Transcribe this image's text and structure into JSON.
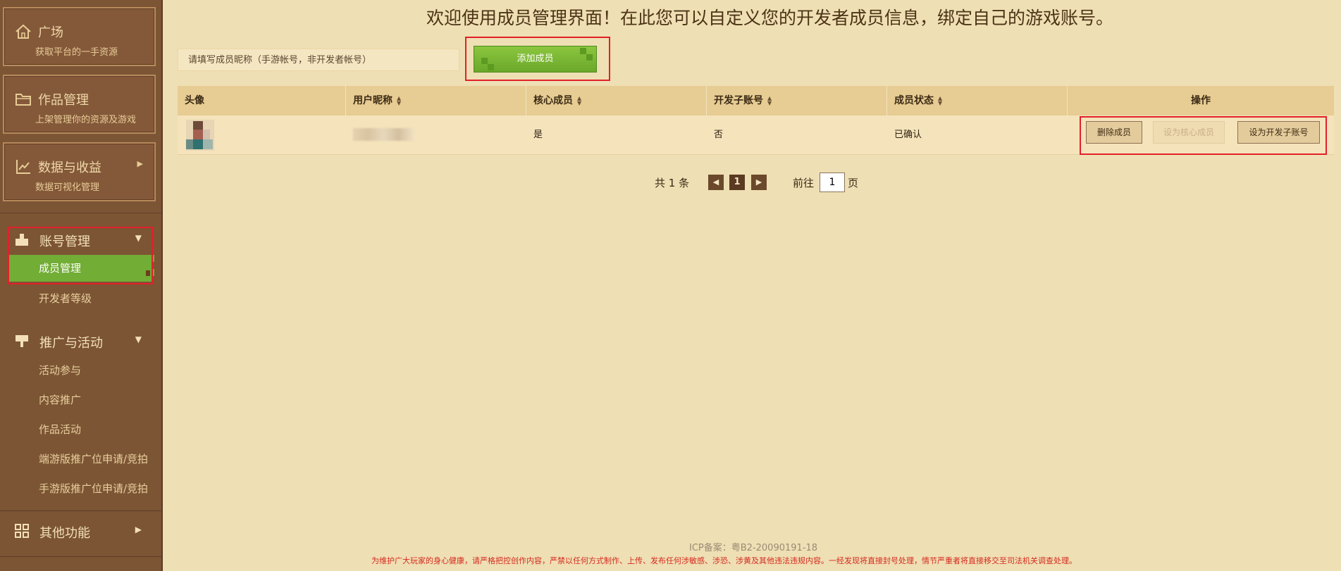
{
  "welcome": "欢迎使用成员管理界面！在此您可以自定义您的开发者成员信息，绑定自己的游戏账号。",
  "sidebar": {
    "cards": [
      {
        "title": "广场",
        "subtitle": "获取平台的一手资源",
        "icon": "home-icon"
      },
      {
        "title": "作品管理",
        "subtitle": "上架管理你的资源及游戏",
        "icon": "folder-icon"
      },
      {
        "title": "数据与收益",
        "subtitle": "数据可视化管理",
        "icon": "chart-icon"
      }
    ],
    "account": {
      "label": "账号管理",
      "icon": "account-icon",
      "items": [
        "成员管理",
        "开发者等级"
      ]
    },
    "promo": {
      "label": "推广与活动",
      "icon": "flag-icon",
      "items": [
        "活动参与",
        "内容推广",
        "作品活动",
        "端游版推广位申请/竞拍",
        "手游版推广位申请/竞拍"
      ]
    },
    "other": {
      "label": "其他功能",
      "icon": "grid-icon"
    }
  },
  "search": {
    "placeholder": "请填写成员昵称（手游帐号，非开发者帐号）"
  },
  "add_button": "添加成员",
  "table": {
    "headers": [
      "头像",
      "用户昵称",
      "核心成员",
      "开发子账号",
      "成员状态",
      "操作"
    ],
    "rows": [
      {
        "core": "是",
        "sub_account": "否",
        "status": "已确认"
      }
    ],
    "actions": [
      "删除成员",
      "设为核心成员",
      "设为开发子账号"
    ]
  },
  "pager": {
    "total": "共 1 条",
    "current": "1",
    "goto": "前往",
    "page_value": "1",
    "page_unit": "页"
  },
  "footer": {
    "icp": "ICP备案：粤B2-20090191-18",
    "warning": "为维护广大玩家的身心健康，请严格把控创作内容，严禁以任何方式制作、上传、发布任何涉敏感、涉恐、涉黄及其他违法违规内容。一经发现将直接封号处理，情节严重者将直接移交至司法机关调查处理。"
  },
  "colors": {
    "accent_green": "#72ad35",
    "highlight_red": "#e2202a",
    "sidebar_bg": "#7c5535",
    "page_bg": "#efdfb4"
  }
}
